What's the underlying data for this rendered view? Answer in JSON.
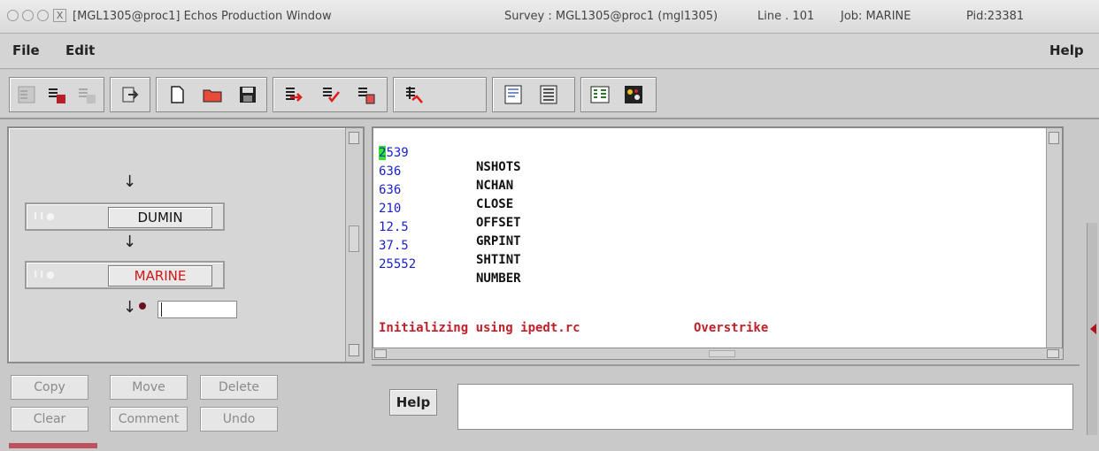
{
  "window": {
    "title": "[MGL1305@proc1] Echos Production Window",
    "survey": "Survey : MGL1305@proc1 (mgl1305)",
    "line": "Line . 101",
    "job": "Job: MARINE",
    "pid": "Pid:23381"
  },
  "menu": {
    "file": "File",
    "edit": "Edit",
    "help": "Help"
  },
  "toolbar": {
    "icons": [
      "tool-hammer-disabled-icon",
      "tool-hammer-run-icon",
      "tool-hammer-gray-icon",
      "export-icon",
      "new-file-icon",
      "open-folder-icon",
      "save-icon",
      "insert-red-arrow-icon",
      "insert-check-icon",
      "insert-file-icon",
      "spell-run-icon",
      "page-view-icon",
      "list-view-icon",
      "columns-icon",
      "network-icon"
    ]
  },
  "flow": {
    "modules": [
      {
        "label": "DUMIN",
        "color": "#111111"
      },
      {
        "label": "MARINE",
        "color": "#d01818"
      }
    ]
  },
  "left_buttons": {
    "copy": "Copy",
    "move": "Move",
    "delete": "Delete",
    "clear": "Clear",
    "comment": "Comment",
    "undo": "Undo"
  },
  "editor": {
    "rows": [
      {
        "cursor": "2",
        "value": "539",
        "key": "NSHOTS"
      },
      {
        "cursor": "",
        "value": "636",
        "key": "NCHAN"
      },
      {
        "cursor": "",
        "value": "636",
        "key": "CLOSE"
      },
      {
        "cursor": "",
        "value": "210",
        "key": "OFFSET"
      },
      {
        "cursor": "",
        "value": "12.5",
        "key": "GRPINT"
      },
      {
        "cursor": "",
        "value": "37.5",
        "key": "SHTINT"
      },
      {
        "cursor": "",
        "value": "25552",
        "key": "NUMBER"
      }
    ],
    "status": "Initializing using ipedt.rc",
    "mode": "Overstrike"
  },
  "help_panel": {
    "button": "Help",
    "text": ""
  }
}
